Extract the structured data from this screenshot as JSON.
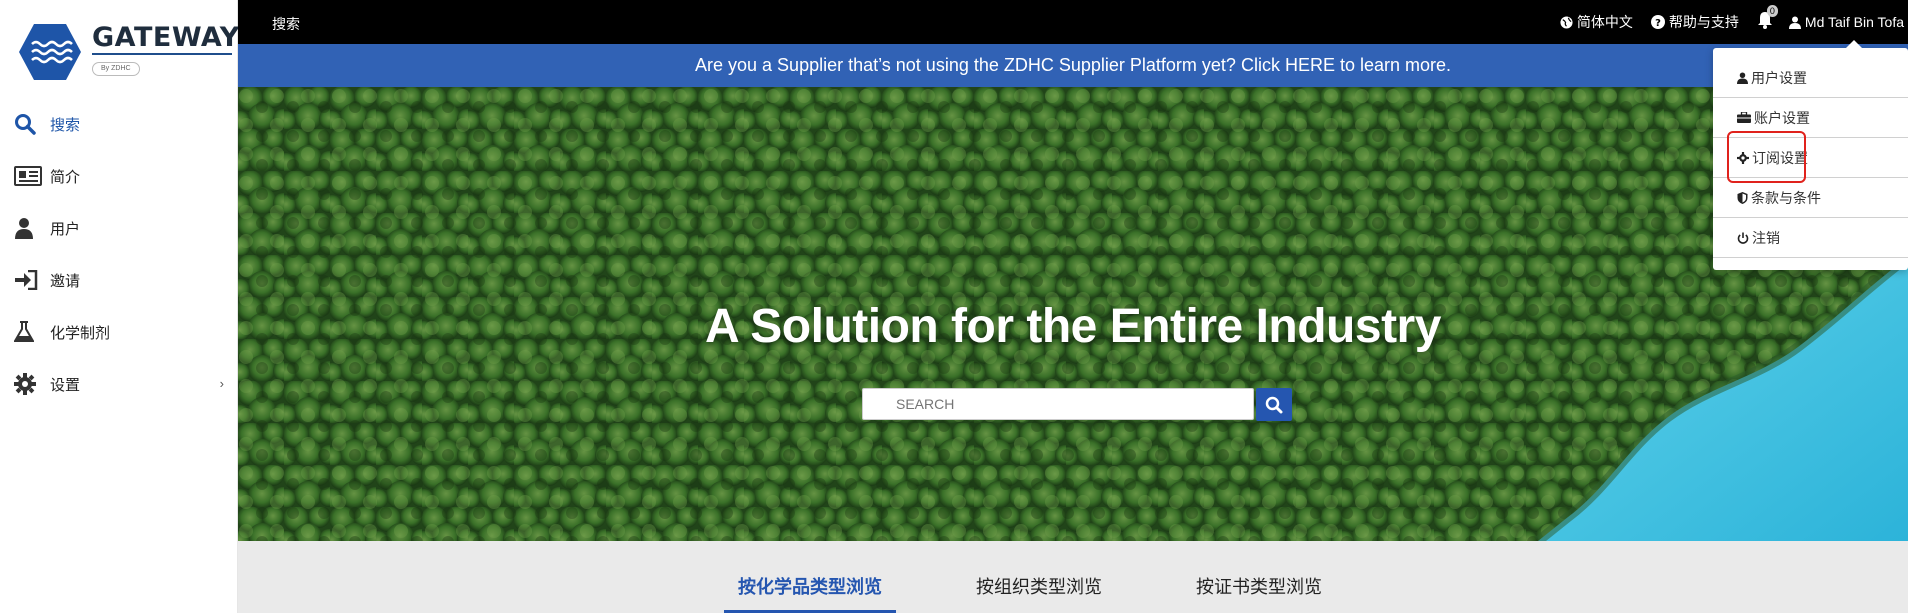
{
  "sidebar": {
    "logo": {
      "title": "GATEWAY",
      "sub": "By  ZDHC"
    },
    "items": [
      {
        "label": "搜索",
        "icon": "search-icon",
        "active": true
      },
      {
        "label": "简介",
        "icon": "profile-card-icon"
      },
      {
        "label": "用户",
        "icon": "user-icon"
      },
      {
        "label": "邀请",
        "icon": "sign-in-icon"
      },
      {
        "label": "化学制剂",
        "icon": "flask-icon"
      },
      {
        "label": "设置",
        "icon": "gear-icon",
        "chevron": "›"
      }
    ]
  },
  "topbar": {
    "search_label": "搜索",
    "language": "简体中文",
    "help": "帮助与支持",
    "notifications": "0",
    "user_name": "Md Taif Bin Tofa"
  },
  "banner": {
    "text": "Are you a Supplier that’s not using the ZDHC Supplier Platform yet? Click HERE to learn more."
  },
  "hero": {
    "title": "A Solution for the Entire Industry",
    "search_placeholder": "SEARCH"
  },
  "tabs": [
    {
      "label": "按化学品类型浏览",
      "active": true
    },
    {
      "label": "按组织类型浏览"
    },
    {
      "label": "按证书类型浏览"
    }
  ],
  "user_menu": {
    "items": [
      {
        "label": "用户设置",
        "icon": "user-icon"
      },
      {
        "label": "账户设置",
        "icon": "briefcase-icon"
      },
      {
        "label": "订阅设置",
        "icon": "gear-icon",
        "highlighted": true
      },
      {
        "label": "条款与条件",
        "icon": "shield-icon"
      },
      {
        "label": "注销",
        "icon": "power-icon"
      }
    ]
  },
  "colors": {
    "accent": "#2556b0",
    "banner": "#3162b5",
    "topbar": "#000000",
    "highlight": "#e0221c"
  }
}
